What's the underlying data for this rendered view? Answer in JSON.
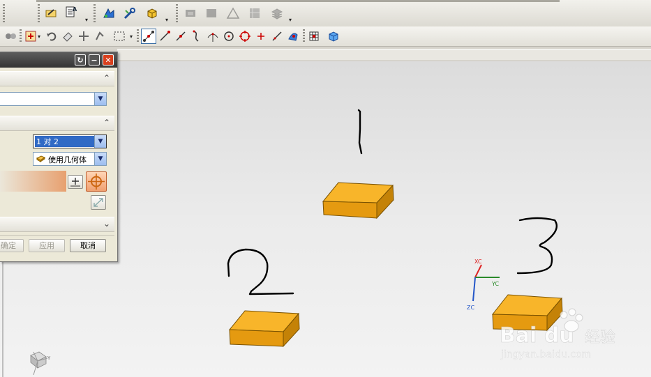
{
  "dialog": {
    "dropdown1_value": "",
    "dropdown2_value": "1 对 2",
    "dropdown3_value": "使用几何体",
    "buttons": {
      "ok": "确定",
      "apply": "应用",
      "cancel": "取消"
    }
  },
  "canvas": {
    "labels": {
      "block1": "1",
      "block2": "2",
      "block3": "3"
    },
    "wcs_axes": {
      "x": "XC",
      "y": "YC",
      "z": "ZC"
    },
    "abs_axis": {
      "y": "Y"
    },
    "watermark": {
      "brand": "Bai du",
      "cn": "经验",
      "url": "jingyan.baidu.com"
    }
  },
  "colors": {
    "block_top": "#f7b52b",
    "block_side": "#c98a0a",
    "titlebar": "#3b3b3b",
    "accent_orange": "#f0a070"
  }
}
